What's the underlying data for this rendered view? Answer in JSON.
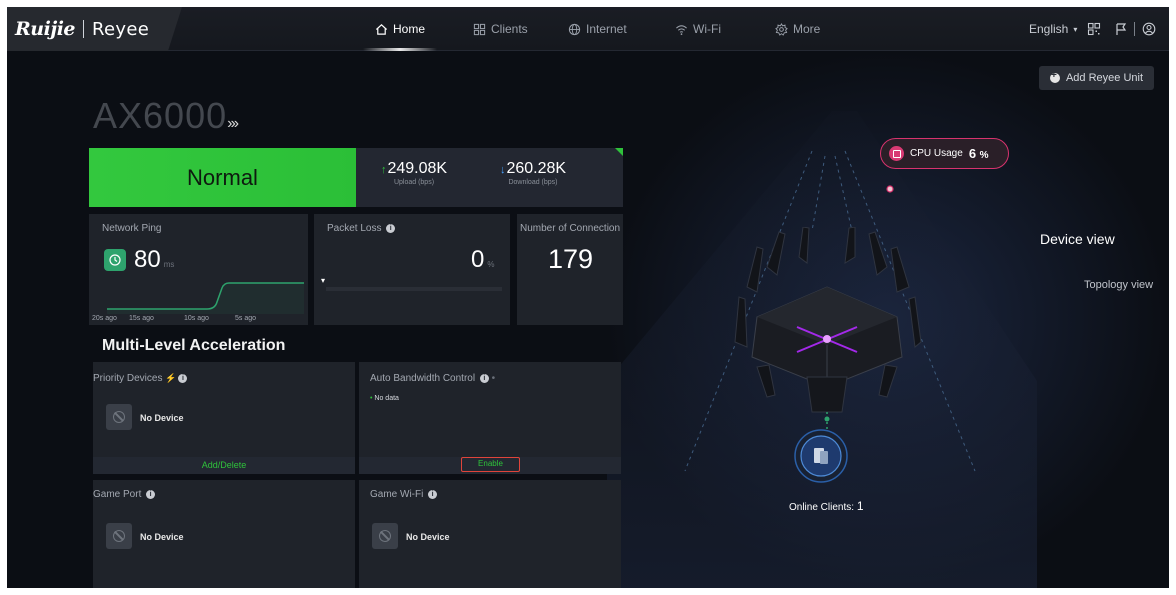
{
  "brand": {
    "left": "Ruijie",
    "right": "Reyee"
  },
  "nav": {
    "items": [
      {
        "label": "Home",
        "icon": "home-icon",
        "active": true
      },
      {
        "label": "Clients",
        "icon": "grid-icon",
        "active": false
      },
      {
        "label": "Internet",
        "icon": "globe-icon",
        "active": false
      },
      {
        "label": "Wi-Fi",
        "icon": "wifi-icon",
        "active": false
      },
      {
        "label": "More",
        "icon": "gear-icon",
        "active": false
      }
    ],
    "language": "English"
  },
  "add_unit_label": "Add Reyee Unit",
  "model": "AX6000",
  "status": {
    "label": "Normal",
    "upload_value": "249.08K",
    "upload_label": "Upload (bps)",
    "download_value": "260.28K",
    "download_label": "Download (bps)"
  },
  "ping": {
    "title": "Network Ping",
    "value": "80",
    "unit": "ms",
    "axis": [
      "20s ago",
      "15s ago",
      "10s ago",
      "5s ago"
    ]
  },
  "packet_loss": {
    "title": "Packet Loss",
    "value": "0",
    "unit": "%"
  },
  "connections": {
    "title": "Number of Connection",
    "value": "179"
  },
  "acceleration": {
    "title": "Multi-Level Acceleration",
    "priority_devices": {
      "title": "Priority Devices",
      "empty": "No Device",
      "action": "Add/Delete"
    },
    "auto_bandwidth": {
      "title": "Auto Bandwidth Control",
      "no_data": "No data",
      "action": "Enable"
    },
    "game_port": {
      "title": "Game Port",
      "empty": "No Device"
    },
    "game_wifi": {
      "title": "Game Wi-Fi",
      "empty": "No Device"
    }
  },
  "cpu": {
    "label": "CPU Usage",
    "value": "6",
    "unit": "%"
  },
  "views": {
    "device": "Device view",
    "topology": "Topology view"
  },
  "online_clients": {
    "label": "Online Clients:",
    "count": "1"
  },
  "colors": {
    "green": "#2fc23b",
    "accent_red": "#e0443b",
    "pink": "#d7336e",
    "link_green": "#2ea36d"
  }
}
